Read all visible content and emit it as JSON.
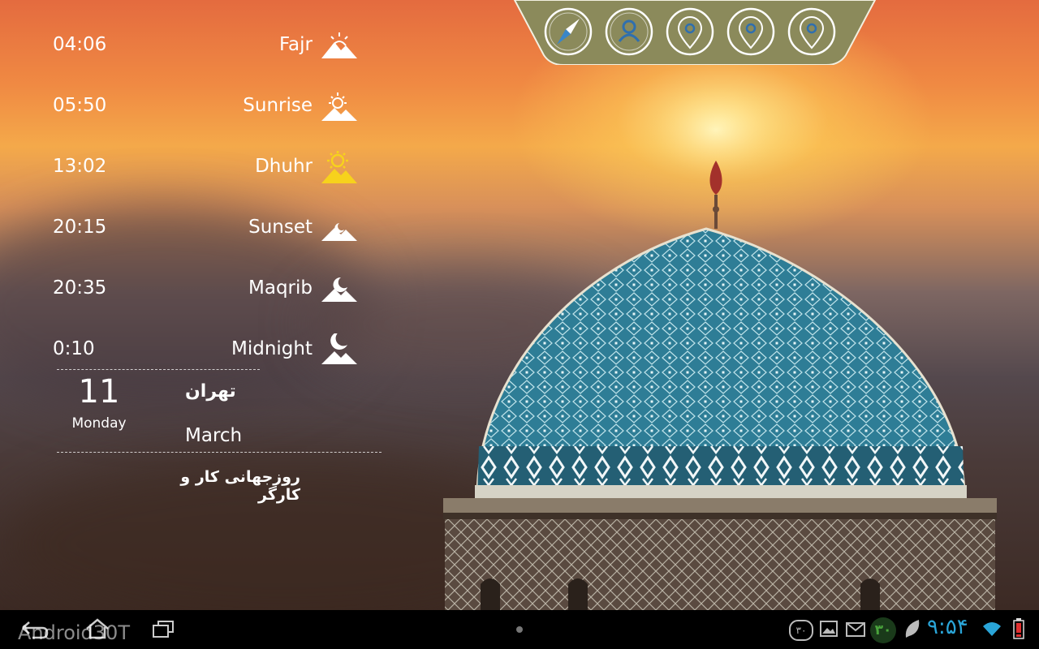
{
  "prayer_times": [
    {
      "time": "04:06",
      "name": "Fajr",
      "icon": "fajr-icon"
    },
    {
      "time": "05:50",
      "name": "Sunrise",
      "icon": "sunrise-icon"
    },
    {
      "time": "13:02",
      "name": "Dhuhr",
      "icon": "dhuhr-icon"
    },
    {
      "time": "20:15",
      "name": "Sunset",
      "icon": "sunset-icon"
    },
    {
      "time": "20:35",
      "name": "Maqrib",
      "icon": "maghrib-icon"
    },
    {
      "time": "0:10",
      "name": "Midnight",
      "icon": "midnight-icon"
    }
  ],
  "date": {
    "day": "11",
    "weekday": "Monday",
    "city": "تهران",
    "month": "March"
  },
  "occasion": "روزجهانی کار و کارگر",
  "toolbar": [
    "compass-icon",
    "contacts-icon",
    "location-pin-icon",
    "location-pin-icon",
    "location-pin-icon"
  ],
  "status_bar": {
    "time": "۹:۵۴",
    "calendar_badge": "۳۰",
    "calendar_badge_outline": "۳۰",
    "watermark": "Android30T"
  },
  "colors": {
    "accent_yellow": "#f7d21c",
    "toolbar_bg": "#8b8a5b",
    "clock_color": "#2aa5d8",
    "badge_color": "#4aa43c",
    "battery_color": "#e03030"
  }
}
